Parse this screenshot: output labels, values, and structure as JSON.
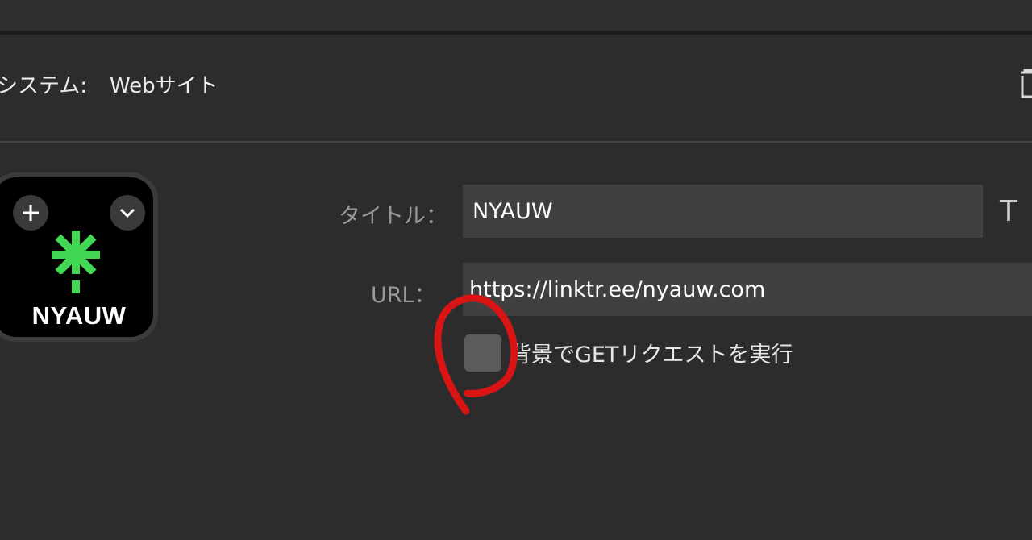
{
  "header": {
    "system_label": "システム:",
    "system_value": "Webサイト"
  },
  "icon_tile": {
    "name": "NYAUW",
    "accent_color": "#43d854",
    "add_icon": "plus-icon",
    "menu_icon": "chevron-down-icon"
  },
  "form": {
    "title_label": "タイトル：",
    "title_value": "NYAUW",
    "url_label": "URL：",
    "url_value": "https://linktr.ee/nyauw.com",
    "text_style_icon": "T",
    "background_get": {
      "label": "背景でGETリクエストを実行",
      "checked": false
    }
  },
  "annotation_color": "#d91414"
}
